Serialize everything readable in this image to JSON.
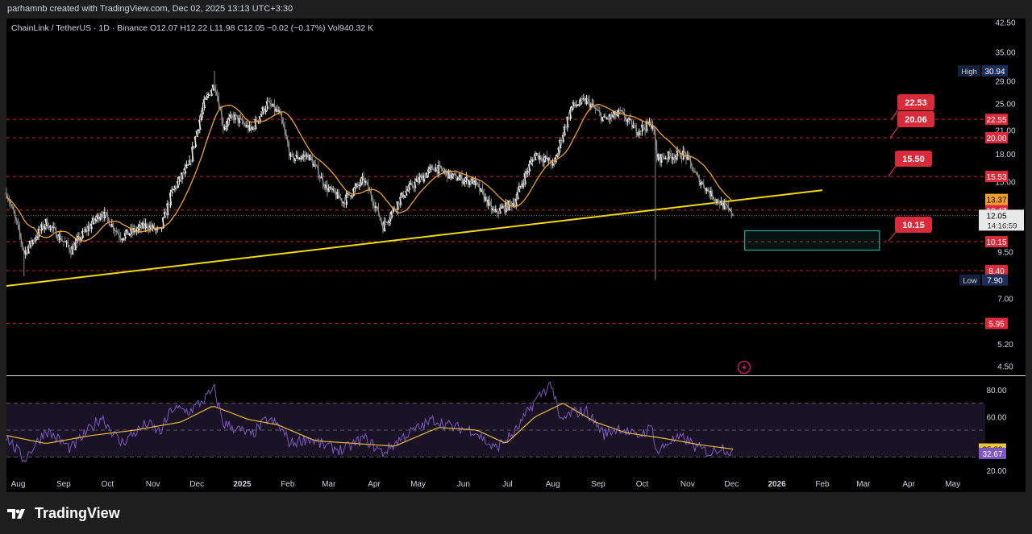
{
  "header": {
    "attribution": "parhamnb created with TradingView.com, Dec 02, 2025 13:13 UTC+3:30"
  },
  "legend": {
    "text": "ChainLink / TetherUS · 1D · Binance  O12.07  H12.22  L11.98  C12.05  −0.02 (−0.17%)  Vol940.32 K"
  },
  "brand": {
    "name": "TradingView"
  },
  "colors": {
    "background": "#000000",
    "frame": "#1e1e1e",
    "trendline": "#f5d90a",
    "ma": "#f0a030",
    "rsi": "#7e57c2",
    "level": "#e0353f",
    "zone": "#26a69a"
  },
  "chart_data": [
    {
      "type": "candlestick",
      "title": "ChainLink / TetherUS · 1D · Binance",
      "x_ticks": [
        "Aug",
        "Sep",
        "Oct",
        "Nov",
        "Dec",
        "2025",
        "Feb",
        "Mar",
        "Apr",
        "May",
        "Jun",
        "Jul",
        "Aug",
        "Sep",
        "Oct",
        "Nov",
        "Dec",
        "2026",
        "Feb",
        "Mar",
        "Apr",
        "May"
      ],
      "y_ticks": [
        "42.50",
        "35.00",
        "29.00",
        "25.00",
        "21.00",
        "18.00",
        "15.00",
        "9.50",
        "7.00",
        "5.20",
        "4.50"
      ],
      "y_scale": "log",
      "ylim": [
        4.2,
        44
      ],
      "current": {
        "price": "12.05",
        "countdown": "14:16:59"
      },
      "axis_badges": [
        {
          "label": "High",
          "value": "30.94"
        },
        {
          "label": "Low",
          "value": "7.90"
        },
        {
          "value": "13.37",
          "kind": "ma"
        }
      ],
      "levels": [
        "22.55",
        "20.00",
        "15.53",
        "12.47",
        "10.15",
        "8.40",
        "5.95"
      ],
      "level_values": [
        22.55,
        20.0,
        15.53,
        12.47,
        10.15,
        8.4,
        5.95
      ],
      "callouts": [
        "22.53",
        "20.06",
        "15.50",
        "10.15"
      ],
      "zone": {
        "low": 9.6,
        "high": 10.9,
        "from": "2025-12-10",
        "to": "2026-03-12"
      },
      "trendline": [
        {
          "date": "2024-07-24",
          "value": 7.6
        },
        {
          "date": "2026-02-01",
          "value": 14.2
        }
      ],
      "close_series": {
        "start": "2024-07-24",
        "end": "2025-12-02",
        "points": [
          [
            "2024-07-24",
            14.0
          ],
          [
            "2024-08-05",
            9.4
          ],
          [
            "2024-08-20",
            11.5
          ],
          [
            "2024-09-06",
            9.6
          ],
          [
            "2024-09-27",
            12.3
          ],
          [
            "2024-10-10",
            10.5
          ],
          [
            "2024-10-28",
            11.3
          ],
          [
            "2024-11-06",
            10.8
          ],
          [
            "2024-11-14",
            14.0
          ],
          [
            "2024-11-26",
            16.8
          ],
          [
            "2024-12-06",
            25.0
          ],
          [
            "2024-12-13",
            28.5
          ],
          [
            "2024-12-19",
            21.5
          ],
          [
            "2024-12-26",
            23.0
          ],
          [
            "2025-01-07",
            21.0
          ],
          [
            "2025-01-18",
            25.0
          ],
          [
            "2025-01-26",
            23.5
          ],
          [
            "2025-02-03",
            17.5
          ],
          [
            "2025-02-15",
            17.8
          ],
          [
            "2025-02-27",
            14.5
          ],
          [
            "2025-03-11",
            13.2
          ],
          [
            "2025-03-25",
            15.2
          ],
          [
            "2025-04-07",
            11.2
          ],
          [
            "2025-04-22",
            14.0
          ],
          [
            "2025-05-12",
            16.5
          ],
          [
            "2025-05-25",
            15.5
          ],
          [
            "2025-06-08",
            15.0
          ],
          [
            "2025-06-22",
            12.2
          ],
          [
            "2025-07-06",
            13.2
          ],
          [
            "2025-07-20",
            18.0
          ],
          [
            "2025-08-02",
            16.8
          ],
          [
            "2025-08-14",
            24.5
          ],
          [
            "2025-08-24",
            25.5
          ],
          [
            "2025-09-05",
            22.5
          ],
          [
            "2025-09-16",
            23.5
          ],
          [
            "2025-09-27",
            21.0
          ],
          [
            "2025-10-08",
            22.0
          ],
          [
            "2025-10-11",
            17.5
          ],
          [
            "2025-10-20",
            17.8
          ],
          [
            "2025-10-30",
            18.0
          ],
          [
            "2025-11-07",
            15.5
          ],
          [
            "2025-11-17",
            13.8
          ],
          [
            "2025-11-24",
            13.0
          ],
          [
            "2025-12-02",
            12.05
          ]
        ]
      },
      "wicks": [
        {
          "date": "2024-08-05",
          "low": 8.1
        },
        {
          "date": "2024-12-13",
          "high": 30.94
        },
        {
          "date": "2025-10-10",
          "low": 7.9
        }
      ]
    },
    {
      "type": "line",
      "title": "RSI",
      "y_ticks": [
        "80.00",
        "60.00",
        "20.00"
      ],
      "ylim": [
        15,
        88
      ],
      "guide_levels": [
        70,
        50,
        30
      ],
      "series": [
        {
          "key": "rsi",
          "value": "32.67",
          "points": [
            [
              "2024-07-24",
              45
            ],
            [
              "2024-08-05",
              28
            ],
            [
              "2024-08-20",
              50
            ],
            [
              "2024-09-06",
              36
            ],
            [
              "2024-09-27",
              60
            ],
            [
              "2024-10-10",
              40
            ],
            [
              "2024-10-28",
              55
            ],
            [
              "2024-11-06",
              48
            ],
            [
              "2024-11-14",
              66
            ],
            [
              "2024-11-26",
              64
            ],
            [
              "2024-12-06",
              73
            ],
            [
              "2024-12-13",
              80
            ],
            [
              "2024-12-19",
              55
            ],
            [
              "2024-12-26",
              52
            ],
            [
              "2025-01-07",
              46
            ],
            [
              "2025-01-18",
              58
            ],
            [
              "2025-01-26",
              53
            ],
            [
              "2025-02-03",
              40
            ],
            [
              "2025-02-15",
              44
            ],
            [
              "2025-02-27",
              38
            ],
            [
              "2025-03-11",
              35
            ],
            [
              "2025-03-25",
              44
            ],
            [
              "2025-04-07",
              33
            ],
            [
              "2025-04-22",
              46
            ],
            [
              "2025-05-12",
              58
            ],
            [
              "2025-05-25",
              52
            ],
            [
              "2025-06-08",
              50
            ],
            [
              "2025-06-22",
              36
            ],
            [
              "2025-07-06",
              48
            ],
            [
              "2025-07-20",
              72
            ],
            [
              "2025-07-31",
              85
            ],
            [
              "2025-08-06",
              56
            ],
            [
              "2025-08-14",
              63
            ],
            [
              "2025-08-24",
              64
            ],
            [
              "2025-09-05",
              47
            ],
            [
              "2025-09-16",
              52
            ],
            [
              "2025-09-27",
              45
            ],
            [
              "2025-10-08",
              52
            ],
            [
              "2025-10-11",
              33
            ],
            [
              "2025-10-20",
              42
            ],
            [
              "2025-10-30",
              44
            ],
            [
              "2025-11-07",
              37
            ],
            [
              "2025-11-17",
              33
            ],
            [
              "2025-11-24",
              38
            ],
            [
              "2025-12-02",
              32.67
            ]
          ]
        },
        {
          "key": "rsi_ma",
          "value": "35.88",
          "points": [
            [
              "2024-07-24",
              46
            ],
            [
              "2024-08-20",
              40
            ],
            [
              "2024-09-20",
              46
            ],
            [
              "2024-10-20",
              50
            ],
            [
              "2024-11-20",
              56
            ],
            [
              "2024-12-12",
              68
            ],
            [
              "2025-01-05",
              58
            ],
            [
              "2025-01-25",
              54
            ],
            [
              "2025-02-20",
              42
            ],
            [
              "2025-03-20",
              40
            ],
            [
              "2025-04-15",
              38
            ],
            [
              "2025-05-15",
              52
            ],
            [
              "2025-06-10",
              50
            ],
            [
              "2025-06-30",
              40
            ],
            [
              "2025-07-20",
              60
            ],
            [
              "2025-08-08",
              70
            ],
            [
              "2025-08-30",
              56
            ],
            [
              "2025-09-20",
              48
            ],
            [
              "2025-10-15",
              44
            ],
            [
              "2025-11-10",
              39
            ],
            [
              "2025-12-02",
              35.88
            ]
          ]
        }
      ]
    }
  ]
}
